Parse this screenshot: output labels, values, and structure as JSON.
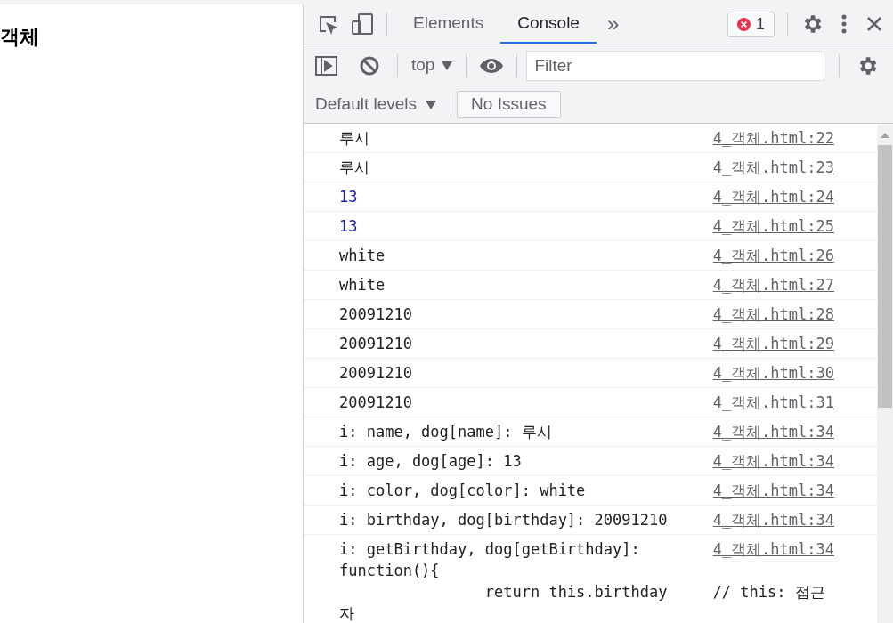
{
  "page": {
    "heading": "객체"
  },
  "devtools": {
    "tabs": [
      {
        "label": "Elements",
        "selected": false
      },
      {
        "label": "Console",
        "selected": true
      }
    ],
    "more_tabs": "»",
    "error_count": "1",
    "context": "top",
    "filter": {
      "placeholder": "Filter"
    },
    "levels": "Default levels",
    "issues": "No Issues",
    "console": [
      {
        "kind": "string",
        "message": "루시",
        "source": "4_객체.html:22"
      },
      {
        "kind": "string",
        "message": "루시",
        "source": "4_객체.html:23"
      },
      {
        "kind": "number",
        "message": "13",
        "source": "4_객체.html:24"
      },
      {
        "kind": "number",
        "message": "13",
        "source": "4_객체.html:25"
      },
      {
        "kind": "string",
        "message": "white",
        "source": "4_객체.html:26"
      },
      {
        "kind": "string",
        "message": "white",
        "source": "4_객체.html:27"
      },
      {
        "kind": "string",
        "message": "20091210",
        "source": "4_객체.html:28"
      },
      {
        "kind": "string",
        "message": "20091210",
        "source": "4_객체.html:29"
      },
      {
        "kind": "string",
        "message": "20091210",
        "source": "4_객체.html:30"
      },
      {
        "kind": "string",
        "message": "20091210",
        "source": "4_객체.html:31"
      },
      {
        "kind": "string",
        "message": "i: name, dog[name]: 루시",
        "source": "4_객체.html:34"
      },
      {
        "kind": "string",
        "message": "i: age, dog[age]: 13",
        "source": "4_객체.html:34"
      },
      {
        "kind": "string",
        "message": "i: color, dog[color]: white",
        "source": "4_객체.html:34"
      },
      {
        "kind": "string",
        "message": "i: birthday, dog[birthday]: 20091210",
        "source": "4_객체.html:34"
      },
      {
        "kind": "string",
        "message": "i: getBirthday, dog[getBirthday]:",
        "continuation": "function(){\n                return this.birthday     // this: 접근자",
        "source": "4_객체.html:34"
      }
    ]
  }
}
